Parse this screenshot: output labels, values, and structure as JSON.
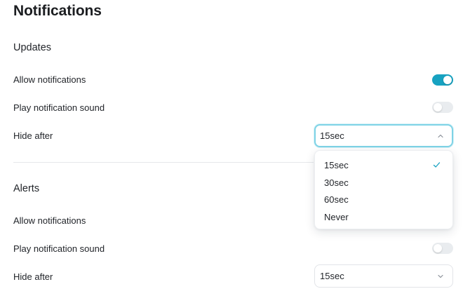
{
  "page_title": "Notifications",
  "sections": [
    {
      "title": "Updates",
      "allow_label": "Allow notifications",
      "allow_on": true,
      "sound_label": "Play notification sound",
      "sound_on": false,
      "hide_label": "Hide after",
      "hide_value": "15sec",
      "dropdown_open": true
    },
    {
      "title": "Alerts",
      "allow_label": "Allow notifications",
      "sound_label": "Play notification sound",
      "sound_on": false,
      "hide_label": "Hide after",
      "hide_value": "15sec",
      "dropdown_open": false
    }
  ],
  "dropdown": {
    "options": [
      "15sec",
      "30sec",
      "60sec",
      "Never"
    ],
    "selected": "15sec"
  },
  "colors": {
    "accent": "#17a2c1",
    "toggle_off": "#e9ecef",
    "focus_border": "#7fd3e6"
  },
  "icons": {
    "select_open": "chevron-up-icon",
    "select_closed": "chevron-down-icon",
    "selected_option": "check-icon"
  }
}
